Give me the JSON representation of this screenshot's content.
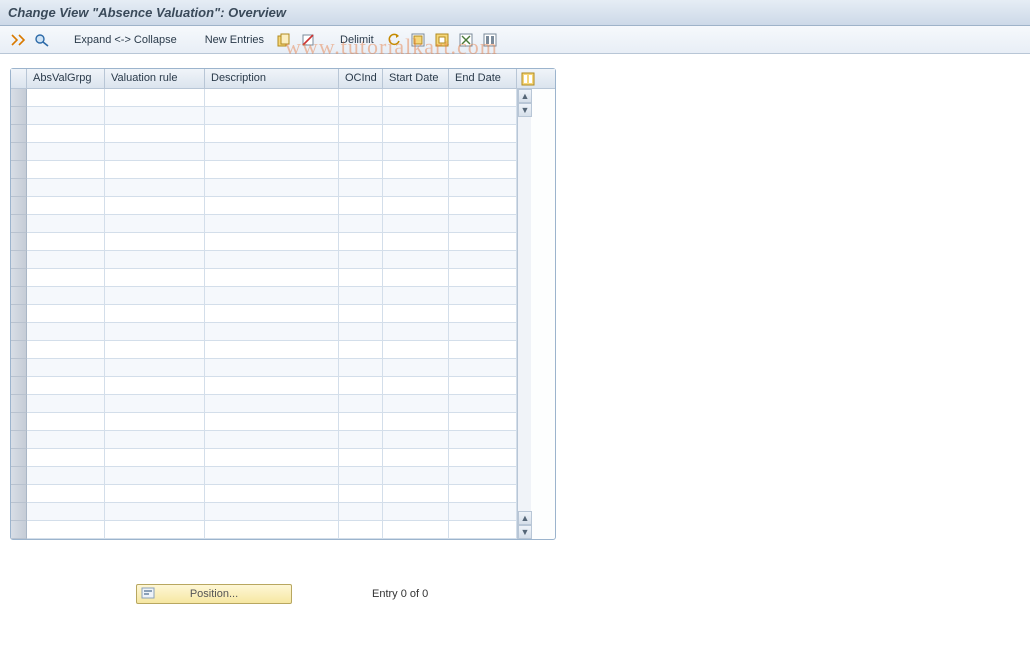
{
  "title": "Change View \"Absence Valuation\": Overview",
  "toolbar": {
    "expand_collapse": "Expand <-> Collapse",
    "new_entries": "New Entries",
    "delimit": "Delimit"
  },
  "columns": {
    "c1": "AbsValGrpg",
    "c2": "Valuation rule",
    "c3": "Description",
    "c4": "OCInd",
    "c5": "Start Date",
    "c6": "End Date"
  },
  "row_count": 25,
  "footer": {
    "position_label": "Position...",
    "entry_text": "Entry 0 of 0"
  },
  "watermark": "www.tutorialkart.com"
}
